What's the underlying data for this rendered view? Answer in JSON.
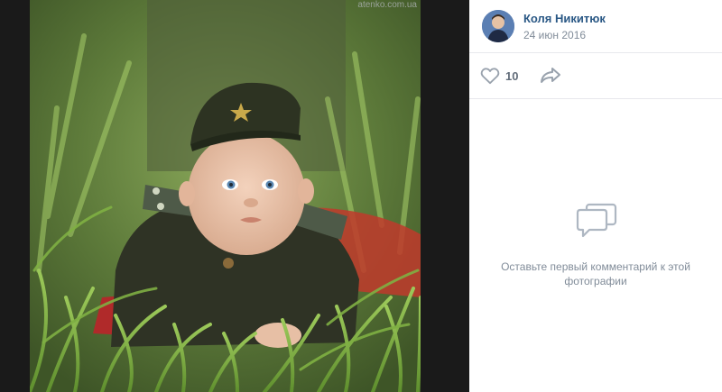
{
  "photo": {
    "watermark": "atenko.com.ua",
    "subject": "photo-of-baby-in-military-uniform"
  },
  "author": {
    "name": "Коля Никитюк",
    "date": "24 июн 2016"
  },
  "actions": {
    "likes": "10",
    "like_icon": "heart-icon",
    "share_icon": "share-icon"
  },
  "comments": {
    "empty_text": "Оставьте первый комментарий к этой фотографии",
    "icon": "comment-bubble-icon"
  },
  "colors": {
    "link": "#2a5885",
    "muted": "#818c99",
    "icon": "#99a2ad"
  }
}
